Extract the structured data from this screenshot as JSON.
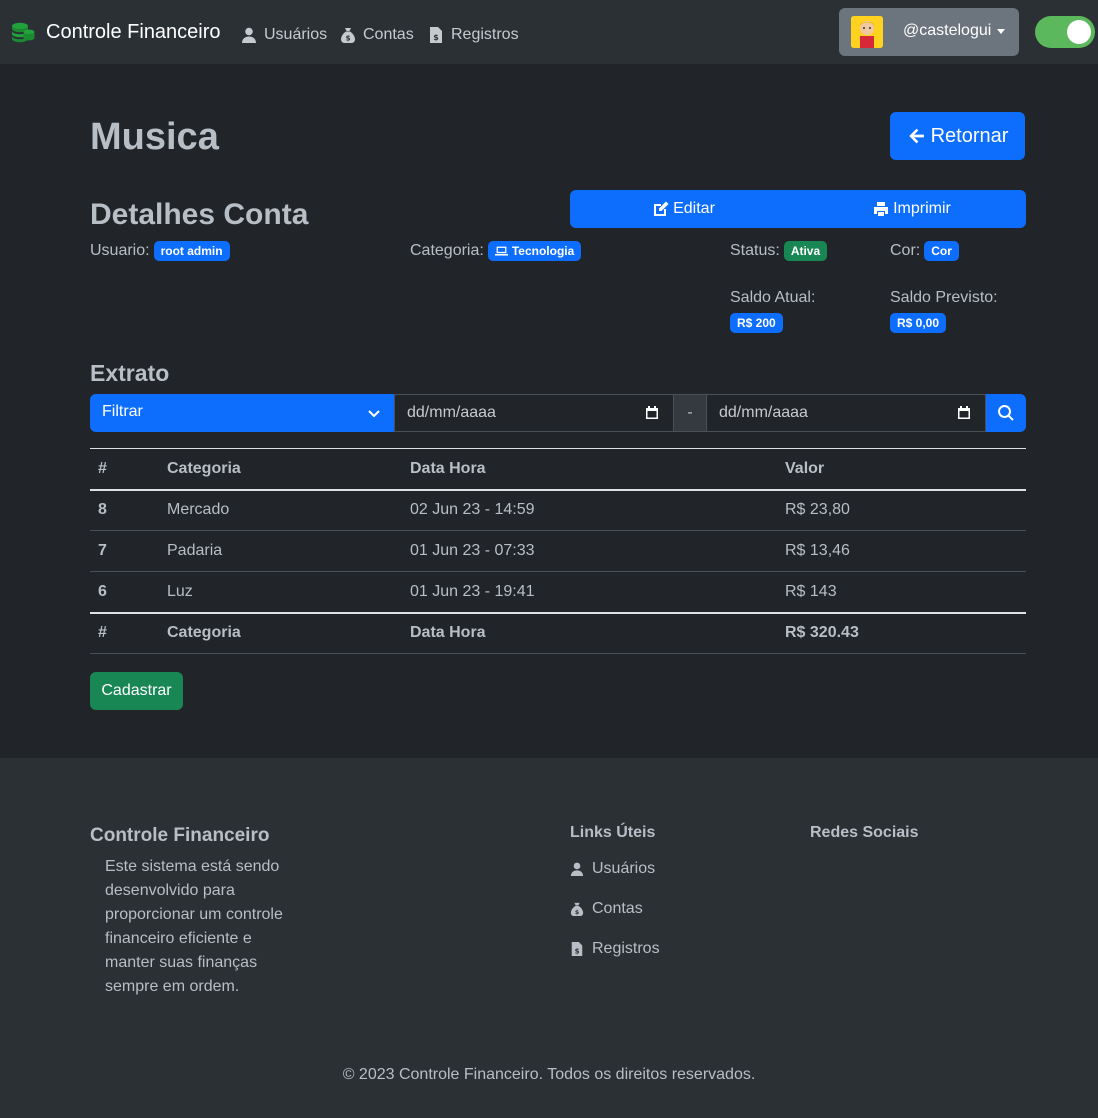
{
  "navbar": {
    "brand": "Controle Financeiro",
    "brand_icon": "coins-icon",
    "links": [
      {
        "label": "Usuários",
        "icon": "user-icon"
      },
      {
        "label": "Contas",
        "icon": "money-bag-icon"
      },
      {
        "label": "Registros",
        "icon": "file-invoice-dollar-icon"
      }
    ],
    "user": "@castelogui",
    "theme_toggle_on": true
  },
  "page": {
    "title": "Musica",
    "return_label": "Retornar"
  },
  "details": {
    "title": "Detalhes Conta",
    "edit_label": "Editar",
    "print_label": "Imprimir",
    "usuario_label": "Usuario:",
    "usuario_value": "root admin",
    "categoria_label": "Categoria:",
    "categoria_value": "Tecnologia",
    "status_label": "Status:",
    "status_value": "Ativa",
    "cor_label": "Cor:",
    "cor_value": "Cor",
    "saldo_atual_label": "Saldo Atual:",
    "saldo_atual_value": "R$ 200",
    "saldo_previsto_label": "Saldo Previsto:",
    "saldo_previsto_value": "R$ 0,00"
  },
  "extrato": {
    "title": "Extrato",
    "filter_value": "Filtrar",
    "date_from": "dd/mm/aaaa",
    "separator": "-",
    "date_to": "dd/mm/aaaa",
    "columns": [
      "#",
      "Categoria",
      "Data Hora",
      "Valor"
    ],
    "rows": [
      {
        "id": "8",
        "categoria": "Mercado",
        "data_hora": "02 Jun 23 - 14:59",
        "valor": "R$ 23,80"
      },
      {
        "id": "7",
        "categoria": "Padaria",
        "data_hora": "01 Jun 23 - 07:33",
        "valor": "R$ 13,46"
      },
      {
        "id": "6",
        "categoria": "Luz",
        "data_hora": "01 Jun 23 - 19:41",
        "valor": "R$ 143"
      }
    ],
    "footer": {
      "id": "#",
      "categoria": "Categoria",
      "data_hora": "Data Hora",
      "valor": "R$ 320.43"
    },
    "cadastrar_label": "Cadastrar"
  },
  "footer": {
    "title": "Controle Financeiro",
    "description": "Este sistema está sendo desenvolvido para proporcionar um controle financeiro eficiente e manter suas finanças sempre em ordem.",
    "links_title": "Links Úteis",
    "links": [
      "Usuários",
      "Contas",
      "Registros"
    ],
    "social_title": "Redes Sociais",
    "copyright": "© 2023 Controle Financeiro. Todos os direitos reservados."
  },
  "colors": {
    "background": "#212529",
    "navbar": "#2b3035",
    "primary": "#0d6efd",
    "success": "#198754",
    "toggle": "#5cb85c"
  }
}
